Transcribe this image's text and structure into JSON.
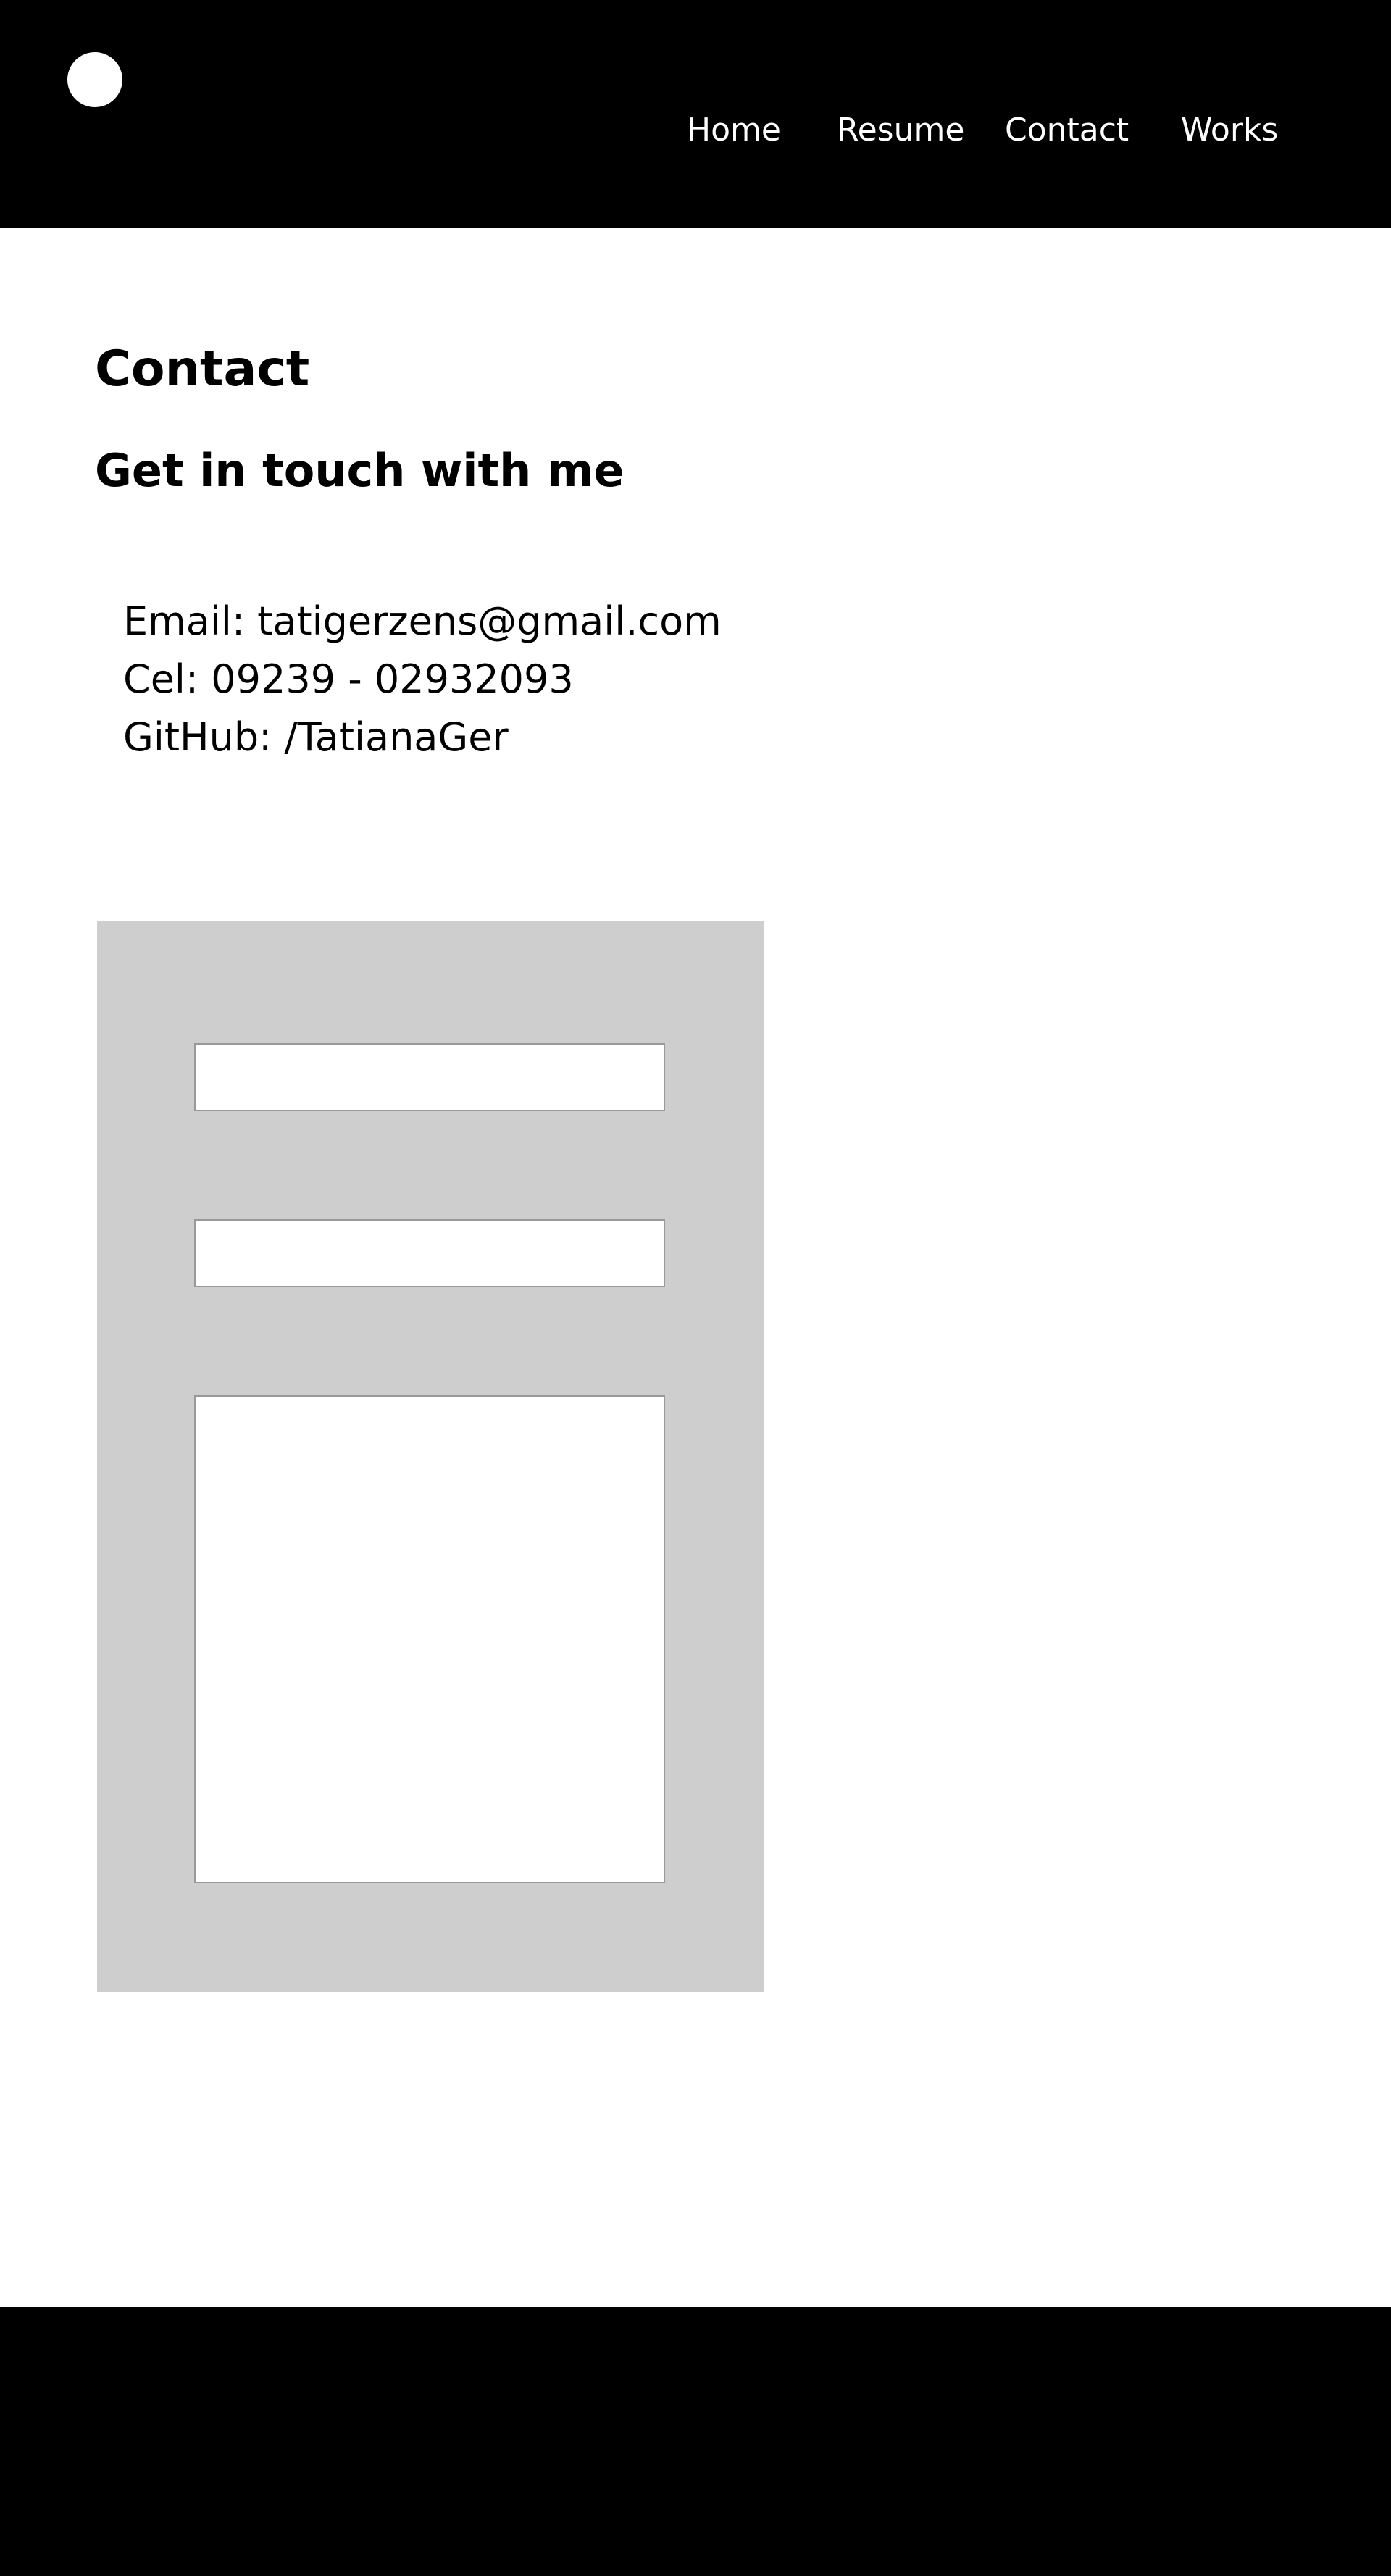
{
  "header": {
    "logo": "circle-logo",
    "nav": {
      "home": "Home",
      "resume": "Resume",
      "contact": "Contact",
      "works": "Works"
    }
  },
  "main": {
    "title": "Contact",
    "subtitle": "Get in touch with me",
    "contact_info": {
      "email": "Email: tatigerzens@gmail.com",
      "phone": "Cel: 09239 - 02932093",
      "github": "GitHub: /TatianaGer"
    }
  },
  "form": {
    "field_1_value": "",
    "field_2_value": "",
    "message_value": ""
  },
  "colors": {
    "header_bg": "#000000",
    "footer_bg": "#000000",
    "nav_text": "#ffffff",
    "form_panel_bg": "#cecece",
    "input_bg": "#ffffff",
    "input_border": "#999999"
  }
}
